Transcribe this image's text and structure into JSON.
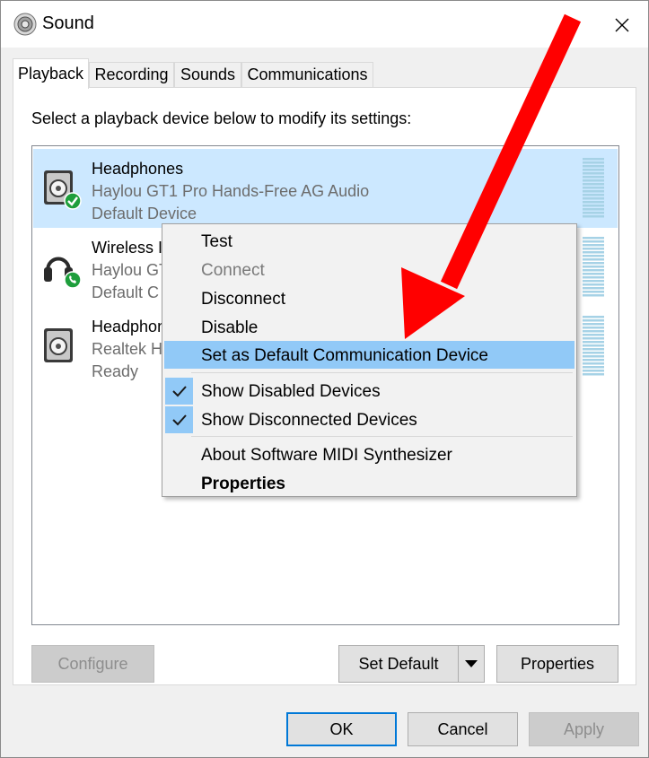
{
  "window": {
    "title": "Sound",
    "close_glyph": "✕"
  },
  "tabs": [
    {
      "label": "Playback",
      "active": true
    },
    {
      "label": "Recording",
      "active": false
    },
    {
      "label": "Sounds",
      "active": false
    },
    {
      "label": "Communications",
      "active": false
    }
  ],
  "instruction": "Select a playback device below to modify its settings:",
  "devices": [
    {
      "name": "Headphones",
      "description": "Haylou GT1 Pro Hands-Free AG Audio",
      "status": "Default Device",
      "icon": "speaker-default-icon",
      "selected": true
    },
    {
      "name": "Wireless I",
      "description": "Haylou GT",
      "status": "Default C",
      "icon": "headset-communication-icon",
      "selected": false
    },
    {
      "name": "Headphon",
      "description": "Realtek H",
      "status": "Ready",
      "icon": "speaker-icon",
      "selected": false
    }
  ],
  "context_menu": {
    "items": [
      {
        "label": "Test",
        "state": "normal"
      },
      {
        "label": "Connect",
        "state": "disabled"
      },
      {
        "label": "Disconnect",
        "state": "normal"
      },
      {
        "label": "Disable",
        "state": "normal"
      },
      {
        "label": "Set as Default Communication Device",
        "state": "highlighted"
      },
      {
        "label": "Show Disabled Devices",
        "state": "checked"
      },
      {
        "label": "Show Disconnected Devices",
        "state": "checked"
      },
      {
        "label": "About Software MIDI Synthesizer",
        "state": "normal"
      },
      {
        "label": "Properties",
        "state": "bold"
      }
    ]
  },
  "buttons": {
    "configure": "Configure",
    "set_default": "Set Default",
    "properties": "Properties",
    "ok": "OK",
    "cancel": "Cancel",
    "apply": "Apply"
  },
  "colors": {
    "selection": "#cce8ff",
    "menu_highlight": "#91c9f7",
    "annotation_arrow": "#ff0000",
    "status_green": "#1e9e3c"
  }
}
